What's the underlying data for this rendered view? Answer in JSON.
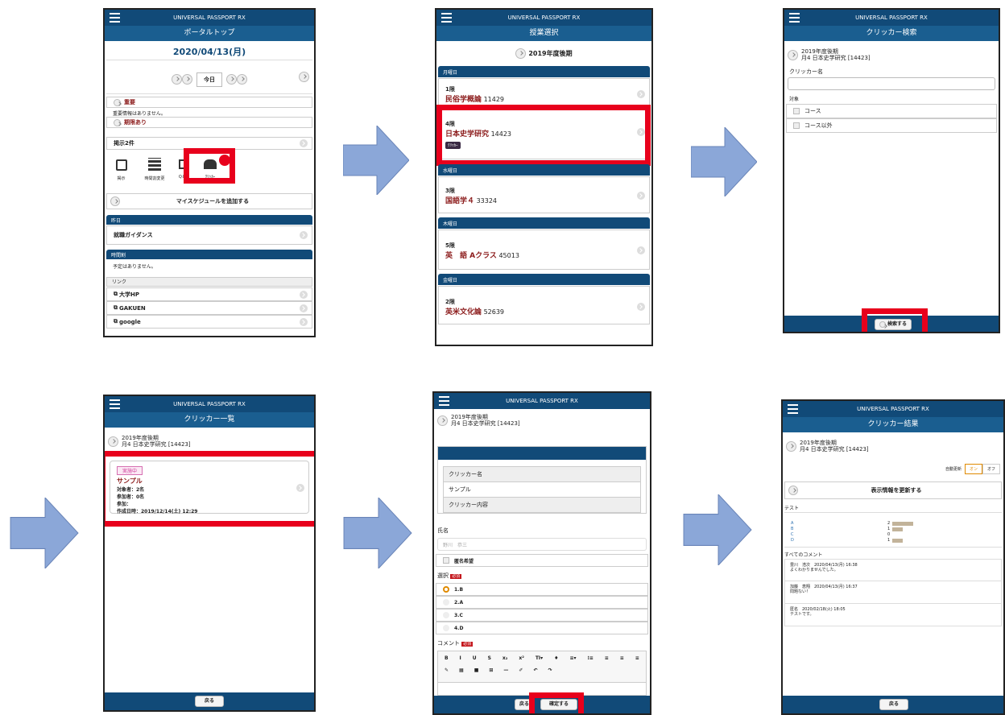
{
  "app_title": "UNIVERSAL PASSPORT RX",
  "s1": {
    "title": "ポータルトップ",
    "date": "2020/04/13(月)",
    "today": "今日",
    "important_h": "重要",
    "important_t": "重要情報はありません。",
    "notice_h": "期限あり",
    "notices": "掲示2件",
    "icons": [
      "掲示",
      "時間割変更",
      "Q＆A",
      "ｸﾘｯｶｰ"
    ],
    "add_schedule": "マイスケジュールを追加する",
    "today_h": "昨日",
    "today_item": "就職ガイダンス",
    "timetable_h": "時間割",
    "timetable_t": "予定はありません。",
    "links_h": "リンク",
    "links": [
      "大学HP",
      "GAKUEN",
      "google"
    ]
  },
  "s2": {
    "title": "授業選択",
    "term": "2019年度後期",
    "groups": [
      {
        "day": "月曜日",
        "items": [
          {
            "period": "1限",
            "name": "民俗学概論",
            "code": "11429"
          },
          {
            "period": "4限",
            "name": "日本史学研究",
            "code": "14423",
            "badge": "ｸﾘｯｶｰ"
          }
        ]
      },
      {
        "day": "水曜日",
        "items": [
          {
            "period": "3限",
            "name": "国語学４",
            "code": "33324"
          }
        ]
      },
      {
        "day": "木曜日",
        "items": [
          {
            "period": "5限",
            "name": "英　語 Aクラス",
            "code": "45013"
          }
        ]
      },
      {
        "day": "金曜日",
        "items": [
          {
            "period": "2限",
            "name": "英米文化論",
            "code": "52639"
          }
        ]
      }
    ]
  },
  "s3": {
    "title": "クリッカー検索",
    "ctx1": "2019年度後期",
    "ctx2": "月4 日本史学研究 [14423]",
    "name_label": "クリッカー名",
    "target_label": "対象",
    "opt1": "コース",
    "opt2": "コース以外",
    "search": "検索する"
  },
  "s4": {
    "title": "クリッカー一覧",
    "ctx1": "2019年度後期",
    "ctx2": "月4 日本史学研究 [14423]",
    "status": "実施中",
    "name": "サンプル",
    "l1": "対象者：2名",
    "l2": "参加者：0名",
    "l3": "参加：",
    "l4": "作成日時：2019/12/14(土) 12:29",
    "back": "戻る"
  },
  "s5": {
    "ctx1": "2019年度後期",
    "ctx2": "月4 日本史学研究 [14423]",
    "t_name_h": "クリッカー名",
    "t_name_v": "サンプル",
    "t_content_h": "クリッカー内容",
    "name_label": "氏名",
    "name_value": "野川　恭三",
    "anon": "匿名希望",
    "select_label": "選択",
    "required": "必須",
    "options": [
      "1.B",
      "2.A",
      "3.C",
      "4.D"
    ],
    "comment_label": "コメント",
    "toolbar1": [
      "B",
      "I",
      "U",
      "S",
      "x₂",
      "x²",
      "TI▾",
      "♦",
      "≡▾",
      "⁝≡",
      "≡",
      "≡",
      "≡"
    ],
    "toolbar2": [
      "✎",
      "▦",
      "■",
      "⊞",
      "—",
      "✐",
      "↶",
      "↷"
    ],
    "back": "戻る",
    "confirm": "確定する"
  },
  "s6": {
    "title": "クリッカー結果",
    "ctx1": "2019年度後期",
    "ctx2": "月4 日本史学研究 [14423]",
    "auto": "自動更新",
    "on": "オン",
    "off": "オフ",
    "refresh": "表示情報を更新する",
    "test": "テスト",
    "results": [
      {
        "label": "A",
        "count": 2
      },
      {
        "label": "B",
        "count": 1
      },
      {
        "label": "C",
        "count": 0
      },
      {
        "label": "D",
        "count": 1
      }
    ],
    "all_comments": "すべてのコメント",
    "comments": [
      {
        "who": "豊川　浩次　2020/04/13(月) 16:38",
        "text": "よくわかりませんでした。"
      },
      {
        "who": "加藤　恵翔　2020/04/13(月) 16:37",
        "text": "問題ない！"
      },
      {
        "who": "匿名　2020/02/18(火) 18:05",
        "text": "テストです。"
      }
    ],
    "back": "戻る"
  }
}
